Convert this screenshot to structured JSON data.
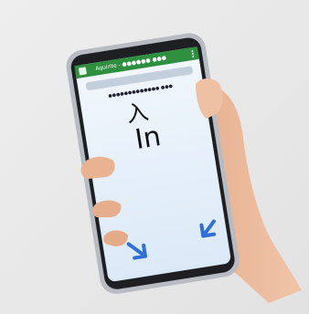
{
  "app": {
    "title": "Aquirite - ●●●●●● ●●●",
    "accent": "#2e8f3f",
    "subtitle": "●●●●●●●●●●●●● ●●●"
  },
  "screen": {
    "kanji": "入",
    "word": "In",
    "arrow_icons": [
      "arrow-down-left-icon",
      "arrow-down-left-icon"
    ],
    "arrow_color": "#2f6fd6"
  },
  "photo": {
    "background": "#e9e9e9",
    "phone_frame": "#b8bcc2",
    "screen_bg": "#e8f2fb",
    "skin": "#e9b99b"
  }
}
